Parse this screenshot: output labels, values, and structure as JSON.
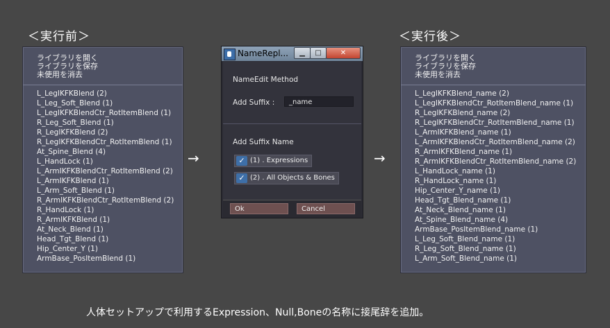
{
  "headings": {
    "before": "＜実行前＞",
    "after": "＜実行後＞"
  },
  "menu": [
    "ライブラリを開く",
    "ライブラリを保存",
    "未使用を消去"
  ],
  "before_items": [
    "L_LegIKFKBlend (2)",
    "L_Leg_Soft_Blend (1)",
    "L_LegIKFKBlendCtr_RotItemBlend (1)",
    "R_Leg_Soft_Blend (1)",
    "R_LegIKFKBlend (2)",
    "R_LegIKFKBlendCtr_RotItemBlend (1)",
    "At_Spine_Blend (4)",
    "L_HandLock (1)",
    "L_ArmIKFKBlendCtr_RotItemBlend (2)",
    "L_ArmIKFKBlend (1)",
    "L_Arm_Soft_Blend (1)",
    "R_ArmIKFKBlendCtr_RotItemBlend (2)",
    "R_HandLock (1)",
    "R_ArmIKFKBlend (1)",
    "At_Neck_Blend (1)",
    "Head_Tgt_Blend (1)",
    "Hip_Center_Y (1)",
    "ArmBase_PosItemBlend (1)"
  ],
  "after_items": [
    "L_LegIKFKBlend_name (2)",
    "L_LegIKFKBlendCtr_RotItemBlend_name (1)",
    "R_LegIKFKBlend_name (2)",
    "R_LegIKFKBlendCtr_RotItemBlend_name (1)",
    "L_ArmIKFKBlend_name (1)",
    "L_ArmIKFKBlendCtr_RotItemBlend_name (2)",
    "R_ArmIKFKBlend_name (1)",
    "R_ArmIKFKBlendCtr_RotItemBlend_name (2)",
    "L_HandLock_name (1)",
    "R_HandLock_name (1)",
    "Hip_Center_Y_name (1)",
    "Head_Tgt_Blend_name (1)",
    "At_Neck_Blend_name (1)",
    "At_Spine_Blend_name (4)",
    "ArmBase_PosItemBlend_name (1)",
    "L_Leg_Soft_Blend_name (1)",
    "R_Leg_Soft_Blend_name (1)",
    "L_Arm_Soft_Blend_name (1)"
  ],
  "arrow": "→",
  "dialog": {
    "title": "NameRepl...",
    "section1": "NameEdit Method",
    "suffix_label": "Add Suffix :",
    "suffix_value": "_name",
    "section2": "Add Suffix Name",
    "options": [
      "(1) . Expressions",
      "(2) . All Objects & Bones"
    ],
    "ok": "Ok",
    "cancel": "Cancel",
    "btn_min": "▁",
    "btn_max": "□",
    "btn_close": "✕",
    "check_glyph": "✓"
  },
  "caption": "人体セットアップで利用するExpression、Null,Boneの名称に接尾辞を追加。"
}
